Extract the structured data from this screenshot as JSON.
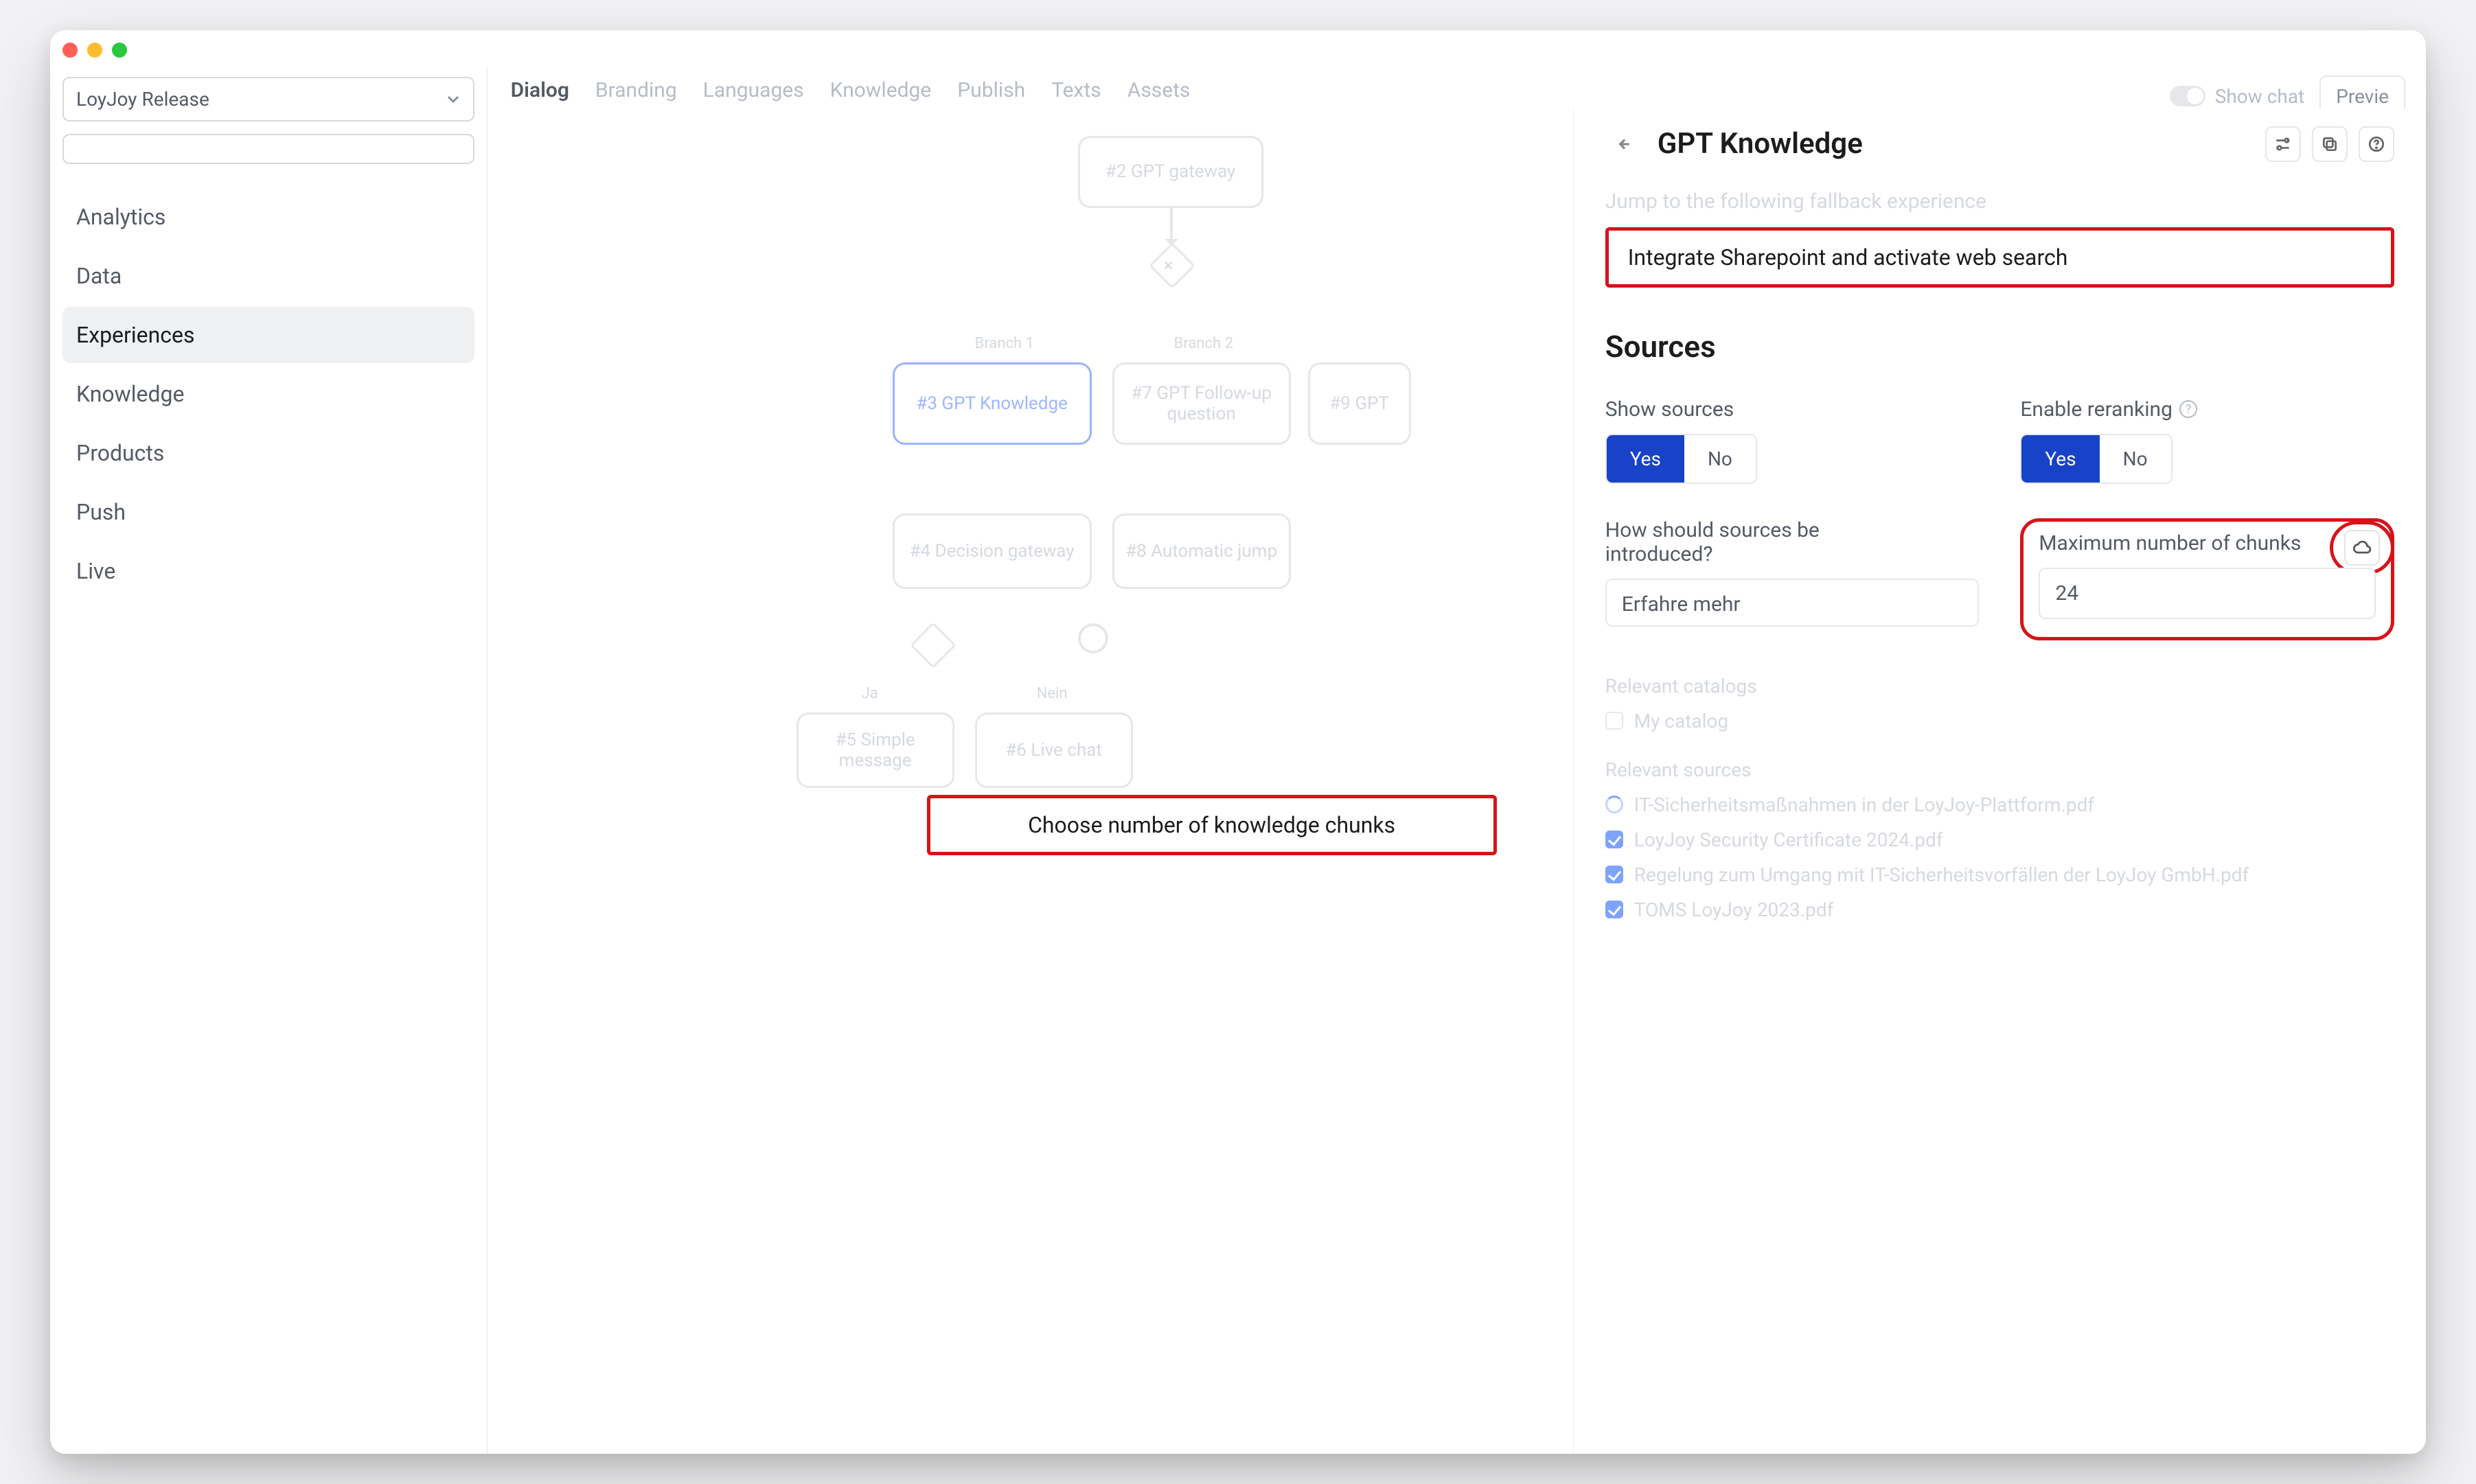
{
  "sidebar": {
    "select_label": "LoyJoy Release",
    "items": [
      "Analytics",
      "Data",
      "Experiences",
      "Knowledge",
      "Products",
      "Push",
      "Live"
    ],
    "active_index": 2
  },
  "top_tabs": {
    "items": [
      "Dialog",
      "Branding",
      "Languages",
      "Knowledge",
      "Publish",
      "Texts",
      "Assets"
    ],
    "active_index": 0,
    "show_chat_label": "Show chat",
    "preview_label": "Previe"
  },
  "flow_nodes": {
    "n2": "#2 GPT gateway",
    "branch1_lbl": "Branch 1",
    "branch2_lbl": "Branch 2",
    "n3": "#3 GPT Knowledge",
    "n7": "#7 GPT Follow-up question",
    "n9": "#9 GPT",
    "n4": "#4 Decision gateway",
    "n8": "#8 Automatic jump",
    "ja": "Ja",
    "nein": "Nein",
    "n5": "#5 Simple message",
    "n6": "#6 Live chat"
  },
  "panel": {
    "title": "GPT Knowledge",
    "fallback_text": "Jump to the following fallback experience",
    "fallback_value": "Integrate Sharepoint and activate web search",
    "sources_heading": "Sources",
    "show_sources_label": "Show sources",
    "enable_rerank_label": "Enable reranking",
    "yes": "Yes",
    "no": "No",
    "intro_label": "How should sources be introduced?",
    "intro_value": "Erfahre mehr",
    "max_chunks_label": "Maximum number of chunks",
    "max_chunks_value": "24",
    "relevant_catalogs": "Relevant catalogs",
    "my_catalog": "My catalog",
    "relevant_sources": "Relevant sources",
    "doc1": "IT-Sicherheitsmaßnahmen in der LoyJoy-Plattform.pdf",
    "doc2": "LoyJoy Security Certificate 2024.pdf",
    "doc3": "Regelung zum Umgang mit IT-Sicherheitsvorfällen der LoyJoy GmbH.pdf",
    "doc4": "TOMS LoyJoy 2023.pdf"
  },
  "annotations": {
    "callout_chunks": "Choose number of knowledge chunks"
  }
}
